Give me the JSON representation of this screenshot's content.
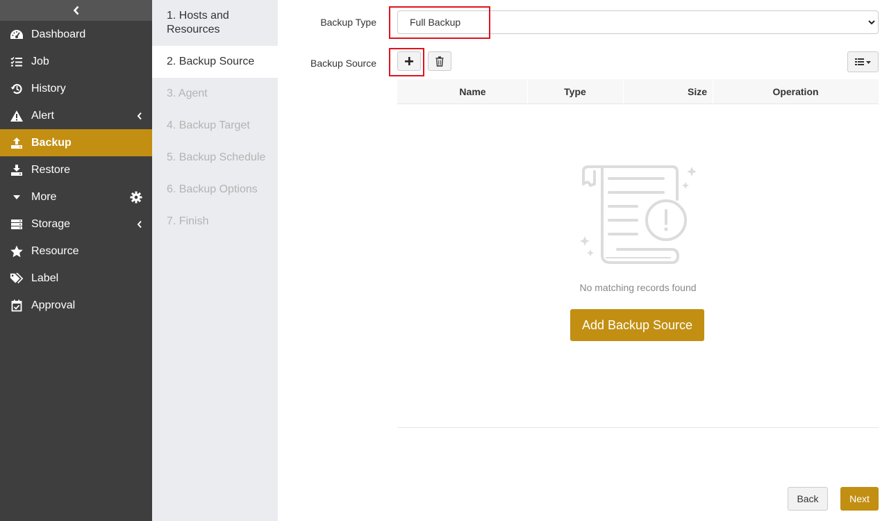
{
  "sidebar": {
    "items": [
      {
        "label": "Dashboard",
        "icon": "dashboard-icon"
      },
      {
        "label": "Job",
        "icon": "tasks-icon"
      },
      {
        "label": "History",
        "icon": "history-icon"
      },
      {
        "label": "Alert",
        "icon": "warning-icon"
      },
      {
        "label": "Backup",
        "icon": "upload-icon"
      },
      {
        "label": "Restore",
        "icon": "download-icon"
      },
      {
        "label": "More",
        "icon": "caret-down-icon"
      },
      {
        "label": "Storage",
        "icon": "server-icon"
      },
      {
        "label": "Resource",
        "icon": "star-icon"
      },
      {
        "label": "Label",
        "icon": "tags-icon"
      },
      {
        "label": "Approval",
        "icon": "calendar-check-icon"
      }
    ],
    "active": "Backup"
  },
  "steps": [
    {
      "label": "1. Hosts and Resources",
      "state": "done"
    },
    {
      "label": "2. Backup Source",
      "state": "current"
    },
    {
      "label": "3. Agent",
      "state": "pending"
    },
    {
      "label": "4. Backup Target",
      "state": "pending"
    },
    {
      "label": "5. Backup Schedule",
      "state": "pending"
    },
    {
      "label": "6. Backup Options",
      "state": "pending"
    },
    {
      "label": "7. Finish",
      "state": "pending"
    }
  ],
  "form": {
    "backup_type_label": "Backup Type",
    "backup_type_value": "Full Backup",
    "backup_source_label": "Backup Source"
  },
  "table": {
    "columns": [
      "Name",
      "Type",
      "Size",
      "Operation"
    ],
    "empty_message": "No matching records found",
    "add_button": "Add Backup Source"
  },
  "buttons": {
    "back": "Back",
    "next": "Next"
  },
  "colors": {
    "accent": "#c28f12",
    "sidebar_bg": "#3e3e3e",
    "highlight": "#e0121b"
  }
}
